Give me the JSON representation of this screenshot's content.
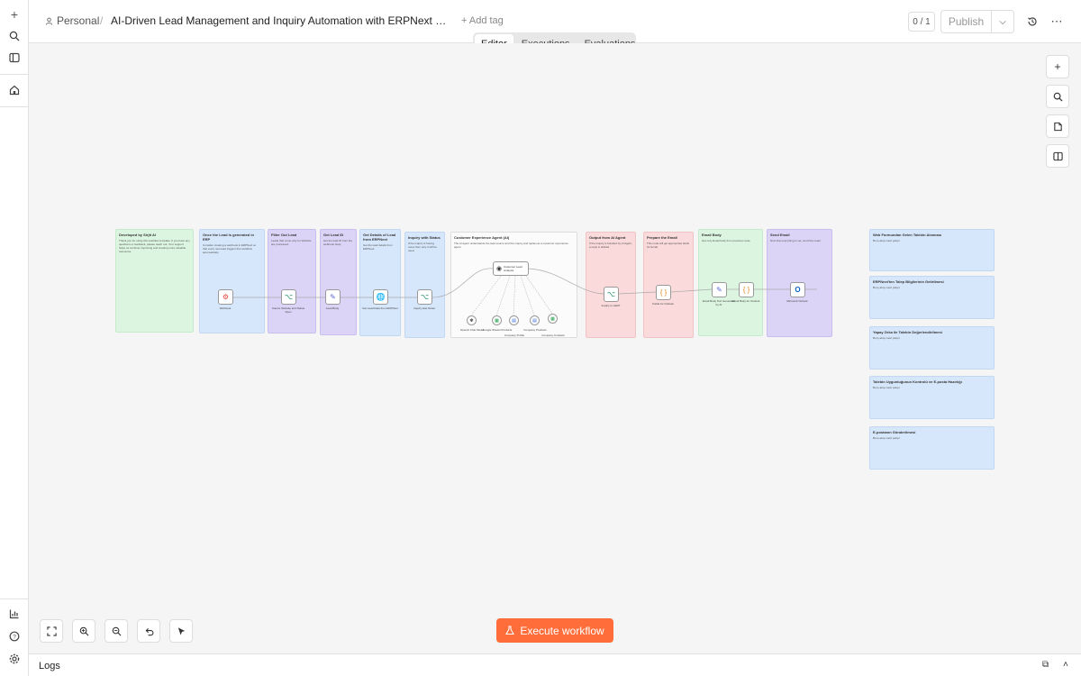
{
  "header": {
    "workspace": "Personal",
    "separator": "/",
    "title": "AI-Driven Lead Management and Inquiry Automation with ERPNext & n8n....",
    "add_tag": "+ Add tag",
    "counter": "0 / 1",
    "publish_label": "Publish"
  },
  "tabs": [
    {
      "label": "Editor",
      "active": true
    },
    {
      "label": "Executions",
      "active": false
    },
    {
      "label": "Evaluations",
      "active": false
    }
  ],
  "execute_label": "Execute workflow",
  "logs_label": "Logs",
  "colors": {
    "accent": "#ff6d3a",
    "sticky_green": "#dcf5e0",
    "sticky_blue": "#d6e6fb",
    "sticky_purple": "#dcd4f7",
    "sticky_red": "#fadada"
  },
  "icons": {
    "rail": [
      "plus-icon",
      "search-icon",
      "sidebar-icon",
      "home-icon",
      "insights-icon",
      "help-icon",
      "settings-icon"
    ],
    "header": [
      "history-icon",
      "more-icon"
    ],
    "right_toolbar": [
      "plus-icon",
      "search-icon",
      "sticky-note-icon",
      "panel-icon"
    ],
    "bottom": [
      "fit-view-icon",
      "zoom-in-icon",
      "zoom-out-icon",
      "undo-icon",
      "pointer-icon"
    ]
  },
  "canvas": {
    "stickies": [
      {
        "title": "Developed by Sirjit AI",
        "body": "Thank you for using this workflow template. If you have any questions or feedback, please reach out. Your support helps us continue improving and creating more valuable resources."
      },
      {
        "title": "Once the Lead is generated in ERP",
        "body": "Consider creating a webhook in ERPNext so that every new lead triggers this workflow automatically."
      },
      {
        "title": "Filter Out Lead",
        "body": "Leads that come only for Website are processed."
      },
      {
        "title": "Get Lead ID",
        "body": "Get the lead ID from the webhook body."
      },
      {
        "title": "Get Details of Lead from ERPNext",
        "body": "Get the lead details from ERPNext."
      },
      {
        "title": "Inquiry with Status",
        "body": "If the inquiry is having notes then only it will be used."
      },
      {
        "title": "Customer Experience Agent (AI)",
        "body": "The AI agent understands the lead source and the inquiry and replies as a customer experience agent."
      },
      {
        "title": "Output from AI Agent",
        "body": "If the Inquiry is handled by AI Agent, a reply is drafted."
      },
      {
        "title": "Prepare the Email",
        "body": "This node will get appropriate fields for Email."
      },
      {
        "title": "Email Body",
        "body": "Get only Email body from previous node."
      },
      {
        "title": "Send Email",
        "body": "Now that everything is set, send the email."
      },
      {
        "title": "Web Formundan Gelen Talebin Alınması",
        "body": "Bu iş akışı nasıl çalışır"
      },
      {
        "title": "ERPNext'ten Talep Bilgilerinin Getirilmesi",
        "body": "Bu iş akışı nasıl çalışır"
      },
      {
        "title": "Yapay Zeka ile Talebin Değerlendirilmesi",
        "body": "Bu iş akışı nasıl çalışır"
      },
      {
        "title": "Talebin Uygunluğunun Kontrolü ve E-posta Hazırlığı",
        "body": "Bu iş akışı nasıl çalışır"
      },
      {
        "title": "E-postanın Gönderilmesi",
        "body": "Bu iş akışı nasıl çalışır"
      }
    ],
    "nodes": [
      {
        "label": "Webhook",
        "icon": "webhook-icon"
      },
      {
        "label": "Source Website and Status Open",
        "icon": "filter-icon"
      },
      {
        "label": "Lead Body",
        "icon": "edit-icon"
      },
      {
        "label": "Get Lead Data from ERPNext",
        "icon": "globe-icon"
      },
      {
        "label": "Inquiry Has Notes",
        "icon": "if-icon"
      },
      {
        "label": "Inquiry is valid?",
        "icon": "if-icon"
      },
      {
        "label": "Fields for Outlook",
        "icon": "code-icon"
      },
      {
        "label": "Email Body Text Generated by AI",
        "icon": "edit-icon"
      },
      {
        "label": "Email Body for Outlook",
        "icon": "code-icon"
      },
      {
        "label": "Microsoft Outlook",
        "icon": "outlook-icon"
      }
    ],
    "agent": {
      "label": "Customer Lead Analysis",
      "icon": "robot-icon"
    },
    "subnodes": [
      {
        "label": "OpenAI Chat Model",
        "icon": "openai-icon"
      },
      {
        "label": "Google Sheets Products",
        "icon": "sheets-icon"
      },
      {
        "label": "Company Profile",
        "icon": "docs-icon"
      },
      {
        "label": "Company Products",
        "icon": "docs-icon"
      },
      {
        "label": "Company Contacts",
        "icon": "sheets-icon"
      }
    ]
  }
}
